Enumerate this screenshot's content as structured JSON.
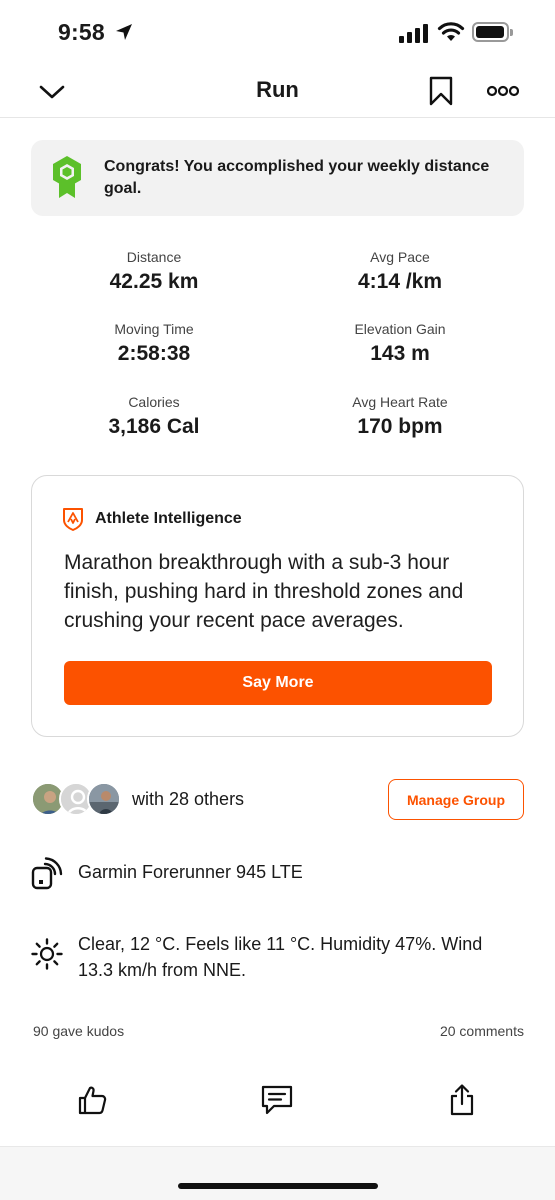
{
  "status_bar": {
    "time": "9:58",
    "icons": [
      "location-arrow-icon",
      "cellular-signal-icon",
      "wifi-icon",
      "battery-icon"
    ]
  },
  "nav": {
    "title": "Run",
    "icons": [
      "chevron-down-icon",
      "bookmark-icon",
      "more-icon"
    ]
  },
  "goal_banner": {
    "icon": "badge-icon",
    "text": "Congrats! You accomplished your weekly distance goal."
  },
  "stats": [
    {
      "label": "Distance",
      "value": "42.25 km"
    },
    {
      "label": "Avg Pace",
      "value": "4:14 /km"
    },
    {
      "label": "Moving Time",
      "value": "2:58:38"
    },
    {
      "label": "Elevation Gain",
      "value": "143 m"
    },
    {
      "label": "Calories",
      "value": "3,186 Cal"
    },
    {
      "label": "Avg Heart Rate",
      "value": "170 bpm"
    }
  ],
  "athlete_intelligence": {
    "icon": "athlete-intelligence-icon",
    "title": "Athlete Intelligence",
    "body": "Marathon breakthrough with a sub-3 hour finish, pushing hard in threshold zones and crushing your recent pace averages.",
    "button_label": "Say More"
  },
  "group": {
    "text": "with 28 others",
    "button_label": "Manage Group"
  },
  "device": {
    "icon": "device-icon",
    "name": "Garmin Forerunner 945 LTE"
  },
  "weather": {
    "icon": "sun-icon",
    "text": "Clear, 12 °C. Feels like 11 °C. Humidity 47%. Wind 13.3 km/h from NNE."
  },
  "social": {
    "kudos": "90 gave kudos",
    "comments": "20 comments"
  },
  "actions": [
    "thumbs-up-icon",
    "comment-icon",
    "share-icon"
  ],
  "colors": {
    "accent": "#fc5200",
    "badge_green": "#5cc02a",
    "banner_bg": "#f2f2f2"
  }
}
